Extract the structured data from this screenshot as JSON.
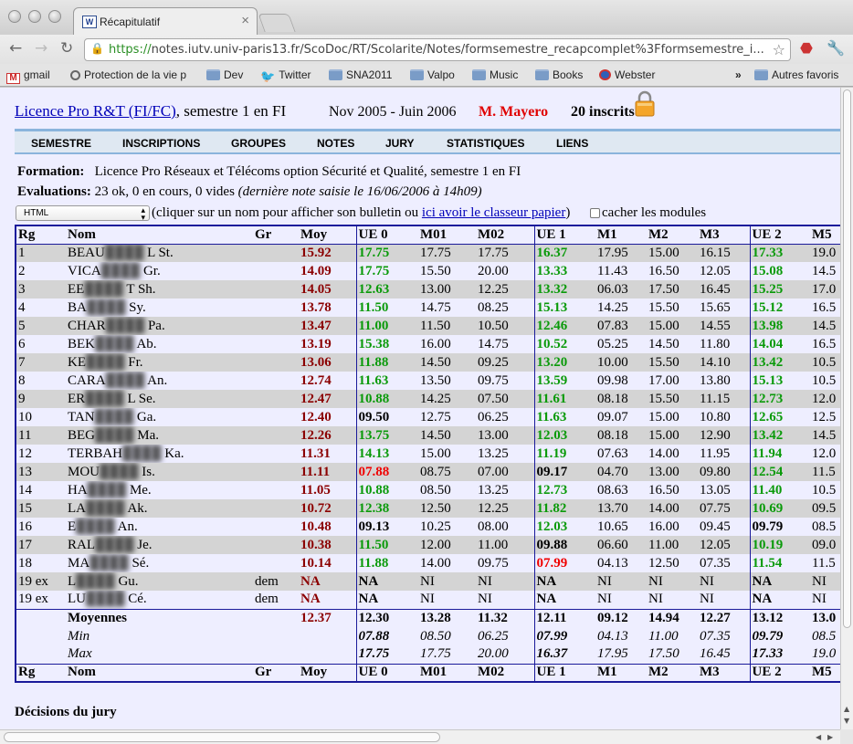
{
  "tab": {
    "title": "Récapitulatif",
    "favicon": "W"
  },
  "omnibox": {
    "scheme": "https://",
    "rest": "notes.iutv.univ-paris13.fr/ScoDoc/RT/Scolarite/Notes/formsemestre_recapcomplet%3Fformsemestre_i..."
  },
  "bookmarks": [
    {
      "label": "gmail",
      "icon": "gmail-icon"
    },
    {
      "label": "Protection de la vie p",
      "icon": "globe-icon"
    },
    {
      "label": "Dev",
      "icon": "folder-icon"
    },
    {
      "label": "Twitter",
      "icon": "twitter-icon"
    },
    {
      "label": "SNA2011",
      "icon": "folder-icon"
    },
    {
      "label": "Valpo",
      "icon": "folder-icon"
    },
    {
      "label": "Music",
      "icon": "folder-icon"
    },
    {
      "label": "Books",
      "icon": "folder-icon"
    },
    {
      "label": "Webster",
      "icon": "webster-icon"
    }
  ],
  "bookmarks_more": "»",
  "bookmarks_other": "Autres favoris",
  "header": {
    "program_link": "Licence Pro R&T (FI/FC)",
    "semester": ", semestre 1 en FI",
    "dates": "Nov 2005 - Juin 2006",
    "responsible": "M. Mayero",
    "enrolled": "20 inscrits"
  },
  "menu": [
    "SEMESTRE",
    "INSCRIPTIONS",
    "GROUPES",
    "NOTES",
    "JURY",
    "STATISTIQUES",
    "LIENS"
  ],
  "info": {
    "formation_label": "Formation:",
    "formation_value": "Licence Pro Réseaux et Télécoms option Sécurité et Qualité, semestre 1 en FI",
    "evaluations_label": "Evaluations:",
    "evaluations_value": "23 ok, 0 en cours, 0 vides",
    "evaluations_note": "(dernière note saisie le 16/06/2006 à 14h09)"
  },
  "format_select": {
    "value": "HTML"
  },
  "hint": {
    "before": "(cliquer sur un nom pour afficher son bulletin ou ",
    "link": "ici avoir le classeur papier",
    "after": ")"
  },
  "hide_modules_label": "cacher les modules",
  "table": {
    "columns": [
      "Rg",
      "Nom",
      "Gr",
      "Moy",
      "UE 0",
      "M01",
      "M02",
      "UE 1",
      "M1",
      "M2",
      "M3",
      "UE 2",
      "M5"
    ],
    "rows": [
      {
        "rg": "1",
        "nom_a": "BEAU",
        "nom_b": "L St.",
        "gr": "",
        "moy": "15.92",
        "ue0": "17.75",
        "ue0c": "green",
        "m01": "17.75",
        "m02": "17.75",
        "ue1": "16.37",
        "ue1c": "green",
        "m1": "17.95",
        "m2": "15.00",
        "m3": "16.15",
        "ue2": "17.33",
        "ue2c": "green",
        "m5": "19.0"
      },
      {
        "rg": "2",
        "nom_a": "VICA",
        "nom_b": "Gr.",
        "gr": "",
        "moy": "14.09",
        "ue0": "17.75",
        "ue0c": "green",
        "m01": "15.50",
        "m02": "20.00",
        "ue1": "13.33",
        "ue1c": "green",
        "m1": "11.43",
        "m2": "16.50",
        "m3": "12.05",
        "ue2": "15.08",
        "ue2c": "green",
        "m5": "14.5"
      },
      {
        "rg": "3",
        "nom_a": "EE",
        "nom_b": "T Sh.",
        "gr": "",
        "moy": "14.05",
        "ue0": "12.63",
        "ue0c": "green",
        "m01": "13.00",
        "m02": "12.25",
        "ue1": "13.32",
        "ue1c": "green",
        "m1": "06.03",
        "m2": "17.50",
        "m3": "16.45",
        "ue2": "15.25",
        "ue2c": "green",
        "m5": "17.0"
      },
      {
        "rg": "4",
        "nom_a": "BA",
        "nom_b": "Sy.",
        "gr": "",
        "moy": "13.78",
        "ue0": "11.50",
        "ue0c": "green",
        "m01": "14.75",
        "m02": "08.25",
        "ue1": "15.13",
        "ue1c": "green",
        "m1": "14.25",
        "m2": "15.50",
        "m3": "15.65",
        "ue2": "15.12",
        "ue2c": "green",
        "m5": "16.5"
      },
      {
        "rg": "5",
        "nom_a": "CHAR",
        "nom_b": "Pa.",
        "gr": "",
        "moy": "13.47",
        "ue0": "11.00",
        "ue0c": "green",
        "m01": "11.50",
        "m02": "10.50",
        "ue1": "12.46",
        "ue1c": "green",
        "m1": "07.83",
        "m2": "15.00",
        "m3": "14.55",
        "ue2": "13.98",
        "ue2c": "green",
        "m5": "14.5"
      },
      {
        "rg": "6",
        "nom_a": "BEK",
        "nom_b": "Ab.",
        "gr": "",
        "moy": "13.19",
        "ue0": "15.38",
        "ue0c": "green",
        "m01": "16.00",
        "m02": "14.75",
        "ue1": "10.52",
        "ue1c": "green",
        "m1": "05.25",
        "m2": "14.50",
        "m3": "11.80",
        "ue2": "14.04",
        "ue2c": "green",
        "m5": "16.5"
      },
      {
        "rg": "7",
        "nom_a": "KE",
        "nom_b": "Fr.",
        "gr": "",
        "moy": "13.06",
        "ue0": "11.88",
        "ue0c": "green",
        "m01": "14.50",
        "m02": "09.25",
        "ue1": "13.20",
        "ue1c": "green",
        "m1": "10.00",
        "m2": "15.50",
        "m3": "14.10",
        "ue2": "13.42",
        "ue2c": "green",
        "m5": "10.5"
      },
      {
        "rg": "8",
        "nom_a": "CARA",
        "nom_b": "An.",
        "gr": "",
        "moy": "12.74",
        "ue0": "11.63",
        "ue0c": "green",
        "m01": "13.50",
        "m02": "09.75",
        "ue1": "13.59",
        "ue1c": "green",
        "m1": "09.98",
        "m2": "17.00",
        "m3": "13.80",
        "ue2": "15.13",
        "ue2c": "green",
        "m5": "10.5"
      },
      {
        "rg": "9",
        "nom_a": "ER",
        "nom_b": "L Se.",
        "gr": "",
        "moy": "12.47",
        "ue0": "10.88",
        "ue0c": "green",
        "m01": "14.25",
        "m02": "07.50",
        "ue1": "11.61",
        "ue1c": "green",
        "m1": "08.18",
        "m2": "15.50",
        "m3": "11.15",
        "ue2": "12.73",
        "ue2c": "green",
        "m5": "12.0"
      },
      {
        "rg": "10",
        "nom_a": "TAN",
        "nom_b": "Ga.",
        "gr": "",
        "moy": "12.40",
        "ue0": "09.50",
        "ue0c": "black",
        "m01": "12.75",
        "m02": "06.25",
        "ue1": "11.63",
        "ue1c": "green",
        "m1": "09.07",
        "m2": "15.00",
        "m3": "10.80",
        "ue2": "12.65",
        "ue2c": "green",
        "m5": "12.5"
      },
      {
        "rg": "11",
        "nom_a": "BEG",
        "nom_b": "Ma.",
        "gr": "",
        "moy": "12.26",
        "ue0": "13.75",
        "ue0c": "green",
        "m01": "14.50",
        "m02": "13.00",
        "ue1": "12.03",
        "ue1c": "green",
        "m1": "08.18",
        "m2": "15.00",
        "m3": "12.90",
        "ue2": "13.42",
        "ue2c": "green",
        "m5": "14.5"
      },
      {
        "rg": "12",
        "nom_a": "TERBAH",
        "nom_b": "Ka.",
        "gr": "",
        "moy": "11.31",
        "ue0": "14.13",
        "ue0c": "green",
        "m01": "15.00",
        "m02": "13.25",
        "ue1": "11.19",
        "ue1c": "green",
        "m1": "07.63",
        "m2": "14.00",
        "m3": "11.95",
        "ue2": "11.94",
        "ue2c": "green",
        "m5": "12.0"
      },
      {
        "rg": "13",
        "nom_a": "MOU",
        "nom_b": "Is.",
        "gr": "",
        "moy": "11.11",
        "ue0": "07.88",
        "ue0c": "red",
        "m01": "08.75",
        "m02": "07.00",
        "ue1": "09.17",
        "ue1c": "black",
        "m1": "04.70",
        "m2": "13.00",
        "m3": "09.80",
        "ue2": "12.54",
        "ue2c": "green",
        "m5": "11.5"
      },
      {
        "rg": "14",
        "nom_a": "HA",
        "nom_b": "Me.",
        "gr": "",
        "moy": "11.05",
        "ue0": "10.88",
        "ue0c": "green",
        "m01": "08.50",
        "m02": "13.25",
        "ue1": "12.73",
        "ue1c": "green",
        "m1": "08.63",
        "m2": "16.50",
        "m3": "13.05",
        "ue2": "11.40",
        "ue2c": "green",
        "m5": "10.5"
      },
      {
        "rg": "15",
        "nom_a": "LA",
        "nom_b": "Ak.",
        "gr": "",
        "moy": "10.72",
        "ue0": "12.38",
        "ue0c": "green",
        "m01": "12.50",
        "m02": "12.25",
        "ue1": "11.82",
        "ue1c": "green",
        "m1": "13.70",
        "m2": "14.00",
        "m3": "07.75",
        "ue2": "10.69",
        "ue2c": "green",
        "m5": "09.5"
      },
      {
        "rg": "16",
        "nom_a": "E",
        "nom_b": "An.",
        "gr": "",
        "moy": "10.48",
        "ue0": "09.13",
        "ue0c": "black",
        "m01": "10.25",
        "m02": "08.00",
        "ue1": "12.03",
        "ue1c": "green",
        "m1": "10.65",
        "m2": "16.00",
        "m3": "09.45",
        "ue2": "09.79",
        "ue2c": "black",
        "m5": "08.5"
      },
      {
        "rg": "17",
        "nom_a": "RAL",
        "nom_b": "Je.",
        "gr": "",
        "moy": "10.38",
        "ue0": "11.50",
        "ue0c": "green",
        "m01": "12.00",
        "m02": "11.00",
        "ue1": "09.88",
        "ue1c": "black",
        "m1": "06.60",
        "m2": "11.00",
        "m3": "12.05",
        "ue2": "10.19",
        "ue2c": "green",
        "m5": "09.0"
      },
      {
        "rg": "18",
        "nom_a": "MA",
        "nom_b": "Sé.",
        "gr": "",
        "moy": "10.14",
        "ue0": "11.88",
        "ue0c": "green",
        "m01": "14.00",
        "m02": "09.75",
        "ue1": "07.99",
        "ue1c": "red",
        "m1": "04.13",
        "m2": "12.50",
        "m3": "07.35",
        "ue2": "11.54",
        "ue2c": "green",
        "m5": "11.5"
      },
      {
        "rg": "19 ex",
        "nom_a": "L",
        "nom_b": "Gu.",
        "gr": "dem",
        "moy": "NA",
        "ue0": "NA",
        "ue0c": "na",
        "m01": "NI",
        "m02": "NI",
        "ue1": "NA",
        "ue1c": "na",
        "m1": "NI",
        "m2": "NI",
        "m3": "NI",
        "ue2": "NA",
        "ue2c": "na",
        "m5": "NI"
      },
      {
        "rg": "19 ex",
        "nom_a": "LU",
        "nom_b": "Cé.",
        "gr": "dem",
        "moy": "NA",
        "ue0": "NA",
        "ue0c": "na",
        "m01": "NI",
        "m02": "NI",
        "ue1": "NA",
        "ue1c": "na",
        "m1": "NI",
        "m2": "NI",
        "m3": "NI",
        "ue2": "NA",
        "ue2c": "na",
        "m5": "NI"
      }
    ],
    "stats": [
      {
        "label": "Moyennes",
        "moy": "12.37",
        "ue0": "12.30",
        "m01": "13.28",
        "m02": "11.32",
        "ue1": "12.11",
        "m1": "09.12",
        "m2": "14.94",
        "m3": "12.27",
        "ue2": "13.12",
        "m5": "13.0"
      },
      {
        "label": "Min",
        "moy": "",
        "ue0": "07.88",
        "m01": "08.50",
        "m02": "06.25",
        "ue1": "07.99",
        "m1": "04.13",
        "m2": "11.00",
        "m3": "07.35",
        "ue2": "09.79",
        "m5": "08.5"
      },
      {
        "label": "Max",
        "moy": "",
        "ue0": "17.75",
        "m01": "17.75",
        "m02": "20.00",
        "ue1": "16.37",
        "m1": "17.95",
        "m2": "17.50",
        "m3": "16.45",
        "ue2": "17.33",
        "m5": "19.0"
      }
    ]
  },
  "decisions_title": "Décisions du jury"
}
